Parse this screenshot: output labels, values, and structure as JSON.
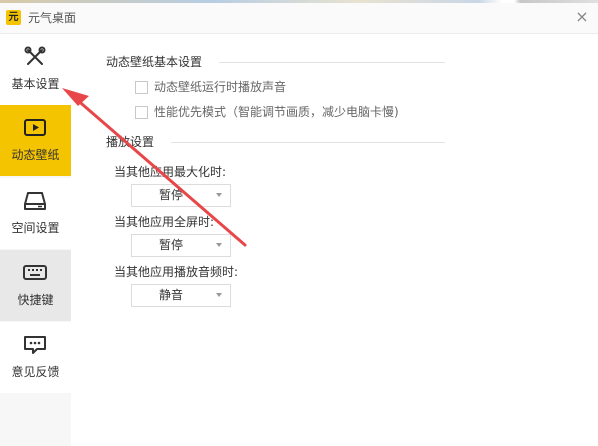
{
  "window": {
    "title": "元气桌面",
    "close_glyph": "×"
  },
  "sidebar": {
    "items": [
      {
        "label": "基本设置",
        "icon": "tools-icon",
        "selected": false
      },
      {
        "label": "动态壁纸",
        "icon": "play-screen-icon",
        "selected": true
      },
      {
        "label": "空间设置",
        "icon": "disk-icon",
        "selected": false
      },
      {
        "label": "快捷键",
        "icon": "keyboard-icon",
        "selected": false
      },
      {
        "label": "意见反馈",
        "icon": "chat-bubble-icon",
        "selected": false
      }
    ]
  },
  "main": {
    "section1": {
      "title": "动态壁纸基本设置",
      "options": [
        {
          "label": "动态壁纸运行时播放声音",
          "checked": false
        },
        {
          "label": "性能优先模式（智能调节画质，减少电脑卡慢)",
          "checked": false
        }
      ]
    },
    "section2": {
      "title": "播放设置",
      "settings": [
        {
          "label": "当其他应用最大化时:",
          "value": "暂停"
        },
        {
          "label": "当其他应用全屏时:",
          "value": "暂停"
        },
        {
          "label": "当其他应用播放音频时:",
          "value": "静音"
        }
      ]
    }
  },
  "colors": {
    "accent": "#f5c400",
    "annotation_arrow": "#e8474a"
  }
}
